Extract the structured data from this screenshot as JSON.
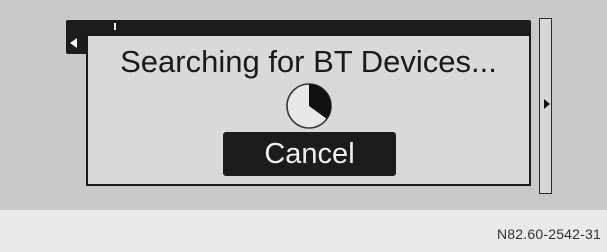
{
  "dialog": {
    "title": "Searching for BT Devices...",
    "cancel_label": "Cancel",
    "progress_fraction": 0.35
  },
  "caption": {
    "reference_code": "N82.60-2542-31"
  },
  "colors": {
    "screen_bg": "#c9c9c9",
    "dialog_bg": "#d9d9d9",
    "button_bg": "#1c1c1c",
    "button_text": "#f0f0f0",
    "caption_bg": "#e9e9e9"
  }
}
